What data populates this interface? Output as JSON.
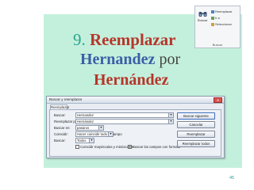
{
  "heading": {
    "number": "9.",
    "line1": "Reemplazar",
    "line2_word": "Hernandez",
    "line2_tail": "por",
    "line3": "Hernández"
  },
  "ribbon": {
    "find_label": "Buscar",
    "replace_label": "Reemplazar",
    "goto_label": "Ir a",
    "select_label": "Seleccionar",
    "group_label": "Buscar"
  },
  "dialog": {
    "title": "Buscar y reemplazar",
    "tab_label": "Reemplazar",
    "fields": {
      "buscar_label": "Buscar:",
      "buscar_value": "Hernandez",
      "reemplazar_label": "Reemplazar por:",
      "reemplazar_value": "Hernández",
      "buscar_en_label": "Buscar en:",
      "buscar_en_value": "pasaros",
      "coincidir_label": "Coincidir:",
      "coincidir_value": "Hacer coincidir todo el campo",
      "buscar2_label": "Buscar:",
      "buscar2_value": "Todos"
    },
    "checkboxes": {
      "match_case_label": "Coincidir mayúsculas y minúsculas",
      "match_case_checked": false,
      "search_format_label": "Buscar los campos con formato",
      "search_format_checked": true
    },
    "buttons": {
      "find_next": "Buscar siguiente",
      "cancel": "Cancelar",
      "replace": "Reemplazar",
      "replace_all": "Reemplazar todos"
    }
  },
  "page_number": "45"
}
